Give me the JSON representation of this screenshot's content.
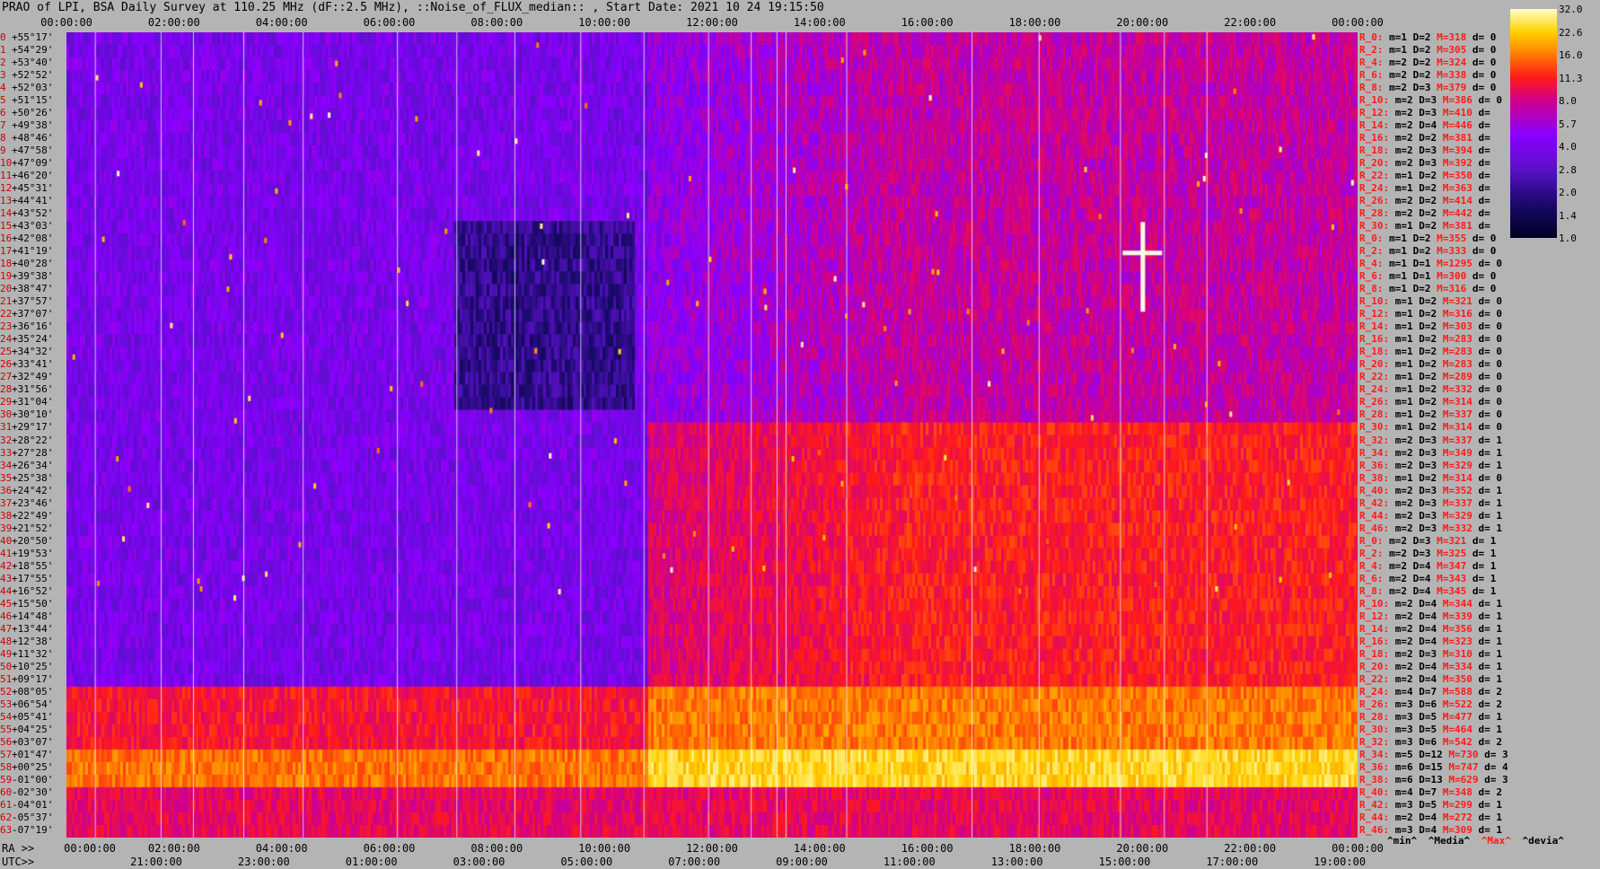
{
  "title": "PRAO of LPI, BSA Daily Survey at 110.25 MHz (dF::2.5 MHz), ::Noise_of_FLUX_median:: , Start Date: 2021 10 24 19:15:50",
  "axis": {
    "ra_prefix": "RA >>",
    "utc_prefix": "UTC>>",
    "top_ticks": [
      "00:00:00",
      "02:00:00",
      "04:00:00",
      "06:00:00",
      "08:00:00",
      "10:00:00",
      "12:00:00",
      "14:00:00",
      "16:00:00",
      "18:00:00",
      "20:00:00",
      "22:00:00",
      "00:00:00"
    ],
    "ra_ticks": [
      "00:00:00",
      "02:00:00",
      "04:00:00",
      "06:00:00",
      "08:00:00",
      "10:00:00",
      "12:00:00",
      "14:00:00",
      "16:00:00",
      "18:00:00",
      "20:00:00",
      "22:00:00",
      "00:00:00"
    ],
    "utc_ticks": [
      "21:00:00",
      "23:00:00",
      "01:00:00",
      "03:00:00",
      "05:00:00",
      "07:00:00",
      "09:00:00",
      "11:00:00",
      "13:00:00",
      "15:00:00",
      "17:00:00",
      "19:00:00"
    ]
  },
  "colorbar": {
    "ticks": [
      "32.0",
      "22.6",
      "16.0",
      "11.3",
      "8.0",
      "5.7",
      "4.0",
      "2.8",
      "2.0",
      "1.4",
      "1.0"
    ],
    "colors": [
      "#000022",
      "#1a0a6a",
      "#5a10c8",
      "#8a00ff",
      "#d0008a",
      "#ff1a1a",
      "#ff7a00",
      "#ffd200",
      "#ffffc8"
    ]
  },
  "declinations": [
    {
      "i": "0",
      "d": "+55°17'"
    },
    {
      "i": "1",
      "d": "+54°29'"
    },
    {
      "i": "2",
      "d": "+53°40'"
    },
    {
      "i": "3",
      "d": "+52°52'"
    },
    {
      "i": "4",
      "d": "+52°03'"
    },
    {
      "i": "5",
      "d": "+51°15'"
    },
    {
      "i": "6",
      "d": "+50°26'"
    },
    {
      "i": "7",
      "d": "+49°38'"
    },
    {
      "i": "8",
      "d": "+48°46'"
    },
    {
      "i": "9",
      "d": "+47°58'"
    },
    {
      "i": "10",
      "d": "+47°09'"
    },
    {
      "i": "11",
      "d": "+46°20'"
    },
    {
      "i": "12",
      "d": "+45°31'"
    },
    {
      "i": "13",
      "d": "+44°41'"
    },
    {
      "i": "14",
      "d": "+43°52'"
    },
    {
      "i": "15",
      "d": "+43°03'"
    },
    {
      "i": "16",
      "d": "+42°08'"
    },
    {
      "i": "17",
      "d": "+41°19'"
    },
    {
      "i": "18",
      "d": "+40°28'"
    },
    {
      "i": "19",
      "d": "+39°38'"
    },
    {
      "i": "20",
      "d": "+38°47'"
    },
    {
      "i": "21",
      "d": "+37°57'"
    },
    {
      "i": "22",
      "d": "+37°07'"
    },
    {
      "i": "23",
      "d": "+36°16'"
    },
    {
      "i": "24",
      "d": "+35°24'"
    },
    {
      "i": "25",
      "d": "+34°32'"
    },
    {
      "i": "26",
      "d": "+33°41'"
    },
    {
      "i": "27",
      "d": "+32°49'"
    },
    {
      "i": "28",
      "d": "+31°56'"
    },
    {
      "i": "29",
      "d": "+31°04'"
    },
    {
      "i": "30",
      "d": "+30°10'"
    },
    {
      "i": "31",
      "d": "+29°17'"
    },
    {
      "i": "32",
      "d": "+28°22'"
    },
    {
      "i": "33",
      "d": "+27°28'"
    },
    {
      "i": "34",
      "d": "+26°34'"
    },
    {
      "i": "35",
      "d": "+25°38'"
    },
    {
      "i": "36",
      "d": "+24°42'"
    },
    {
      "i": "37",
      "d": "+23°46'"
    },
    {
      "i": "38",
      "d": "+22°49'"
    },
    {
      "i": "39",
      "d": "+21°52'"
    },
    {
      "i": "40",
      "d": "+20°50'"
    },
    {
      "i": "41",
      "d": "+19°53'"
    },
    {
      "i": "42",
      "d": "+18°55'"
    },
    {
      "i": "43",
      "d": "+17°55'"
    },
    {
      "i": "44",
      "d": "+16°52'"
    },
    {
      "i": "45",
      "d": "+15°50'"
    },
    {
      "i": "46",
      "d": "+14°48'"
    },
    {
      "i": "47",
      "d": "+13°44'"
    },
    {
      "i": "48",
      "d": "+12°38'"
    },
    {
      "i": "49",
      "d": "+11°32'"
    },
    {
      "i": "50",
      "d": "+10°25'"
    },
    {
      "i": "51",
      "d": "+09°17'"
    },
    {
      "i": "52",
      "d": "+08°05'"
    },
    {
      "i": "53",
      "d": "+06°54'"
    },
    {
      "i": "54",
      "d": "+05°41'"
    },
    {
      "i": "55",
      "d": "+04°25'"
    },
    {
      "i": "56",
      "d": "+03°07'"
    },
    {
      "i": "57",
      "d": "+01°47'"
    },
    {
      "i": "58",
      "d": "+00°25'"
    },
    {
      "i": "59",
      "d": "-01°00'"
    },
    {
      "i": "60",
      "d": "-02°30'"
    },
    {
      "i": "61",
      "d": "-04°01'"
    },
    {
      "i": "62",
      "d": "-05°37'"
    },
    {
      "i": "63",
      "d": "-07°19'"
    }
  ],
  "stats": [
    {
      "r": "R_0:",
      "m": "m=1",
      "D": "D=2",
      "M": "M=318",
      "d": "d= 0"
    },
    {
      "r": "R_2:",
      "m": "m=1",
      "D": "D=2",
      "M": "M=305",
      "d": "d= 0"
    },
    {
      "r": "R_4:",
      "m": "m=2",
      "D": "D=2",
      "M": "M=324",
      "d": "d= 0"
    },
    {
      "r": "R_6:",
      "m": "m=2",
      "D": "D=2",
      "M": "M=338",
      "d": "d= 0"
    },
    {
      "r": "R_8:",
      "m": "m=2",
      "D": "D=3",
      "M": "M=379",
      "d": "d= 0"
    },
    {
      "r": "R_10:",
      "m": "m=2",
      "D": "D=3",
      "M": "M=386",
      "d": "d= 0"
    },
    {
      "r": "R_12:",
      "m": "m=2",
      "D": "D=3",
      "M": "M=410",
      "d": "d="
    },
    {
      "r": "R_14:",
      "m": "m=2",
      "D": "D=4",
      "M": "M=446",
      "d": "d="
    },
    {
      "r": "R_16:",
      "m": "m=2",
      "D": "D=2",
      "M": "M=381",
      "d": "d="
    },
    {
      "r": "R_18:",
      "m": "m=2",
      "D": "D=3",
      "M": "M=394",
      "d": "d="
    },
    {
      "r": "R_20:",
      "m": "m=2",
      "D": "D=3",
      "M": "M=392",
      "d": "d="
    },
    {
      "r": "R_22:",
      "m": "m=1",
      "D": "D=2",
      "M": "M=350",
      "d": "d="
    },
    {
      "r": "R_24:",
      "m": "m=1",
      "D": "D=2",
      "M": "M=363",
      "d": "d="
    },
    {
      "r": "R_26:",
      "m": "m=2",
      "D": "D=2",
      "M": "M=414",
      "d": "d="
    },
    {
      "r": "R_28:",
      "m": "m=2",
      "D": "D=2",
      "M": "M=442",
      "d": "d="
    },
    {
      "r": "R_30:",
      "m": "m=1",
      "D": "D=2",
      "M": "M=381",
      "d": "d="
    },
    {
      "r": "R_0:",
      "m": "m=1",
      "D": "D=2",
      "M": "M=355",
      "d": "d= 0"
    },
    {
      "r": "R_2:",
      "m": "m=1",
      "D": "D=2",
      "M": "M=333",
      "d": "d= 0"
    },
    {
      "r": "R_4:",
      "m": "m=1",
      "D": "D=1",
      "M": "M=1295",
      "d": "d= 0"
    },
    {
      "r": "R_6:",
      "m": "m=1",
      "D": "D=1",
      "M": "M=300",
      "d": "d= 0"
    },
    {
      "r": "R_8:",
      "m": "m=1",
      "D": "D=2",
      "M": "M=316",
      "d": "d= 0"
    },
    {
      "r": "R_10:",
      "m": "m=1",
      "D": "D=2",
      "M": "M=321",
      "d": "d= 0"
    },
    {
      "r": "R_12:",
      "m": "m=1",
      "D": "D=2",
      "M": "M=316",
      "d": "d= 0"
    },
    {
      "r": "R_14:",
      "m": "m=1",
      "D": "D=2",
      "M": "M=303",
      "d": "d= 0"
    },
    {
      "r": "R_16:",
      "m": "m=1",
      "D": "D=2",
      "M": "M=283",
      "d": "d= 0"
    },
    {
      "r": "R_18:",
      "m": "m=1",
      "D": "D=2",
      "M": "M=283",
      "d": "d= 0"
    },
    {
      "r": "R_20:",
      "m": "m=1",
      "D": "D=2",
      "M": "M=283",
      "d": "d= 0"
    },
    {
      "r": "R_22:",
      "m": "m=1",
      "D": "D=2",
      "M": "M=289",
      "d": "d= 0"
    },
    {
      "r": "R_24:",
      "m": "m=1",
      "D": "D=2",
      "M": "M=332",
      "d": "d= 0"
    },
    {
      "r": "R_26:",
      "m": "m=1",
      "D": "D=2",
      "M": "M=314",
      "d": "d= 0"
    },
    {
      "r": "R_28:",
      "m": "m=1",
      "D": "D=2",
      "M": "M=337",
      "d": "d= 0"
    },
    {
      "r": "R_30:",
      "m": "m=1",
      "D": "D=2",
      "M": "M=314",
      "d": "d= 0"
    },
    {
      "r": "R_32:",
      "m": "m=2",
      "D": "D=3",
      "M": "M=337",
      "d": "d= 1"
    },
    {
      "r": "R_34:",
      "m": "m=2",
      "D": "D=3",
      "M": "M=349",
      "d": "d= 1"
    },
    {
      "r": "R_36:",
      "m": "m=2",
      "D": "D=3",
      "M": "M=329",
      "d": "d= 1"
    },
    {
      "r": "R_38:",
      "m": "m=1",
      "D": "D=2",
      "M": "M=314",
      "d": "d= 0"
    },
    {
      "r": "R_40:",
      "m": "m=2",
      "D": "D=3",
      "M": "M=352",
      "d": "d= 1"
    },
    {
      "r": "R_42:",
      "m": "m=2",
      "D": "D=3",
      "M": "M=337",
      "d": "d= 1"
    },
    {
      "r": "R_44:",
      "m": "m=2",
      "D": "D=3",
      "M": "M=329",
      "d": "d= 1"
    },
    {
      "r": "R_46:",
      "m": "m=2",
      "D": "D=3",
      "M": "M=332",
      "d": "d= 1"
    },
    {
      "r": "R_0:",
      "m": "m=2",
      "D": "D=3",
      "M": "M=321",
      "d": "d= 1"
    },
    {
      "r": "R_2:",
      "m": "m=2",
      "D": "D=3",
      "M": "M=325",
      "d": "d= 1"
    },
    {
      "r": "R_4:",
      "m": "m=2",
      "D": "D=4",
      "M": "M=347",
      "d": "d= 1"
    },
    {
      "r": "R_6:",
      "m": "m=2",
      "D": "D=4",
      "M": "M=343",
      "d": "d= 1"
    },
    {
      "r": "R_8:",
      "m": "m=2",
      "D": "D=4",
      "M": "M=345",
      "d": "d= 1"
    },
    {
      "r": "R_10:",
      "m": "m=2",
      "D": "D=4",
      "M": "M=344",
      "d": "d= 1"
    },
    {
      "r": "R_12:",
      "m": "m=2",
      "D": "D=4",
      "M": "M=339",
      "d": "d= 1"
    },
    {
      "r": "R_14:",
      "m": "m=2",
      "D": "D=4",
      "M": "M=356",
      "d": "d= 1"
    },
    {
      "r": "R_16:",
      "m": "m=2",
      "D": "D=4",
      "M": "M=323",
      "d": "d= 1"
    },
    {
      "r": "R_18:",
      "m": "m=2",
      "D": "D=3",
      "M": "M=310",
      "d": "d= 1"
    },
    {
      "r": "R_20:",
      "m": "m=2",
      "D": "D=4",
      "M": "M=334",
      "d": "d= 1"
    },
    {
      "r": "R_22:",
      "m": "m=2",
      "D": "D=4",
      "M": "M=350",
      "d": "d= 1"
    },
    {
      "r": "R_24:",
      "m": "m=4",
      "D": "D=7",
      "M": "M=588",
      "d": "d= 2"
    },
    {
      "r": "R_26:",
      "m": "m=3",
      "D": "D=6",
      "M": "M=522",
      "d": "d= 2"
    },
    {
      "r": "R_28:",
      "m": "m=3",
      "D": "D=5",
      "M": "M=477",
      "d": "d= 1"
    },
    {
      "r": "R_30:",
      "m": "m=3",
      "D": "D=5",
      "M": "M=464",
      "d": "d= 1"
    },
    {
      "r": "R_32:",
      "m": "m=3",
      "D": "D=6",
      "M": "M=542",
      "d": "d= 2"
    },
    {
      "r": "R_34:",
      "m": "m=5",
      "D": "D=12",
      "M": "M=730",
      "d": "d= 3"
    },
    {
      "r": "R_36:",
      "m": "m=6",
      "D": "D=15",
      "M": "M=747",
      "d": "d= 4"
    },
    {
      "r": "R_38:",
      "m": "m=6",
      "D": "D=13",
      "M": "M=629",
      "d": "d= 3"
    },
    {
      "r": "R_40:",
      "m": "m=4",
      "D": "D=7",
      "M": "M=348",
      "d": "d= 2"
    },
    {
      "r": "R_42:",
      "m": "m=3",
      "D": "D=5",
      "M": "M=299",
      "d": "d= 1"
    },
    {
      "r": "R_44:",
      "m": "m=2",
      "D": "D=4",
      "M": "M=272",
      "d": "d= 1"
    },
    {
      "r": "R_46:",
      "m": "m=3",
      "D": "D=4",
      "M": "M=309",
      "d": "d= 1"
    }
  ],
  "legend": {
    "min": "^min^",
    "media": "^Media^",
    "max": "^Max^",
    "devia": "^devia^"
  },
  "chart_data": {
    "type": "heatmap",
    "title": "PRAO of LPI, BSA Daily Survey at 110.25 MHz (dF::2.5 MHz), ::Noise_of_FLUX_median:: , Start Date: 2021 10 24 19:15:50",
    "x_range_ra_hours": [
      0,
      24
    ],
    "rows": 64,
    "colorbar_range": [
      1.0,
      32.0
    ],
    "colorbar_scale": "log",
    "bright_source": {
      "ra_hours": 20.0,
      "row": 17
    },
    "high_noise_rows": [
      57,
      58,
      59
    ]
  }
}
